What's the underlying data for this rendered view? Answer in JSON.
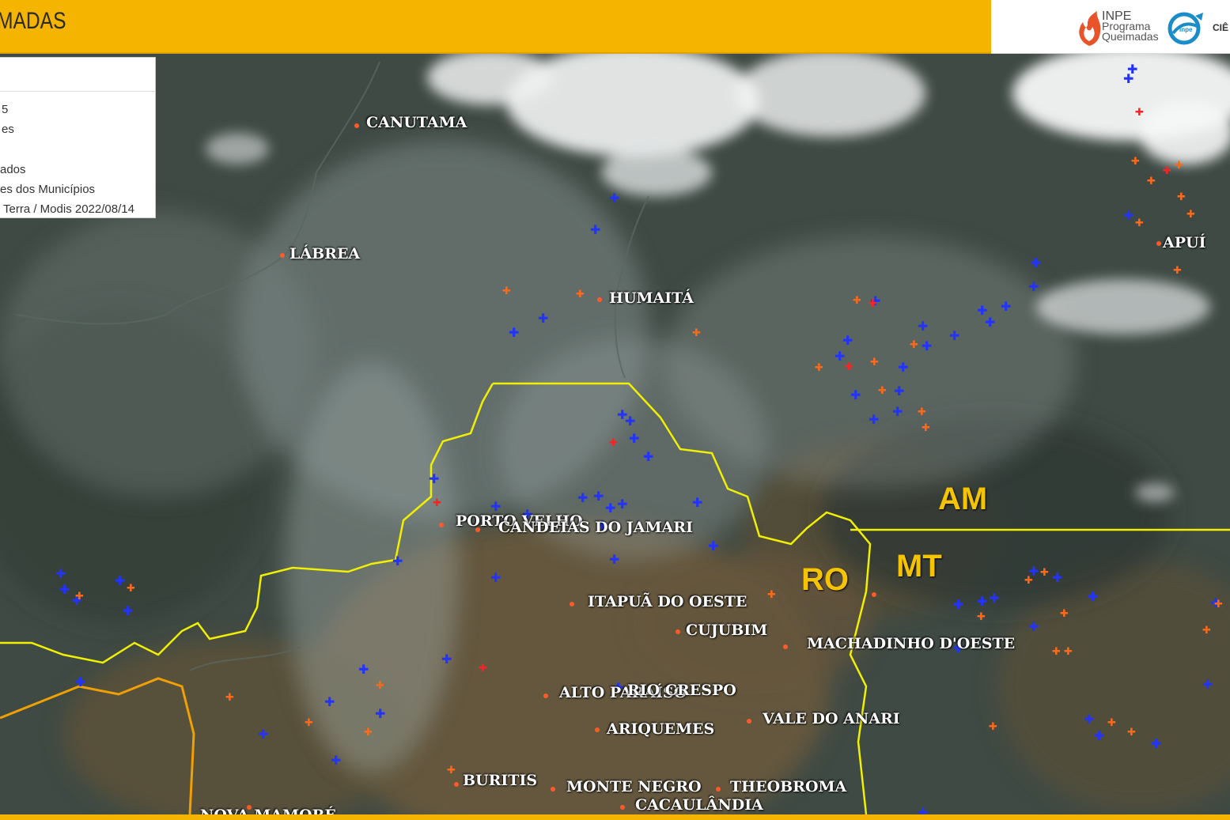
{
  "header": {
    "title": "MADAS",
    "logo": {
      "line1": "INPE",
      "line2": "Programa",
      "line3": "Queimadas",
      "partner_text": "CIÊ"
    }
  },
  "legend": {
    "rows": [
      "5",
      "es",
      "ados",
      "es dos Municípios",
      "Terra / Modis 2022/08/14"
    ]
  },
  "states": [
    "AM",
    "RO",
    "MT"
  ],
  "municipalities": [
    "CANUTAMA",
    "LÁBREA",
    "HUMAITÁ",
    "APUÍ",
    "PORTO VELHO",
    "CANDEIAS DO JAMARI",
    "ITAPUÃ DO OESTE",
    "CUJUBIM",
    "MACHADINHO D'OESTE",
    "ALTO PARAÍSO",
    "RIO CRESPO",
    "VALE DO ANARI",
    "ARIQUEMES",
    "BURITIS",
    "MONTE NEGRO",
    "THEOBROMA",
    "CACAULÂNDIA",
    "NOVA MAMORÉ"
  ],
  "colors": {
    "header": "#f4b400",
    "state_border": "#f0f000",
    "state_label": "#f5c400",
    "hotspot_blue": "#2233ff",
    "hotspot_orange": "#ff6a1a",
    "hotspot_red": "#ff2222"
  }
}
